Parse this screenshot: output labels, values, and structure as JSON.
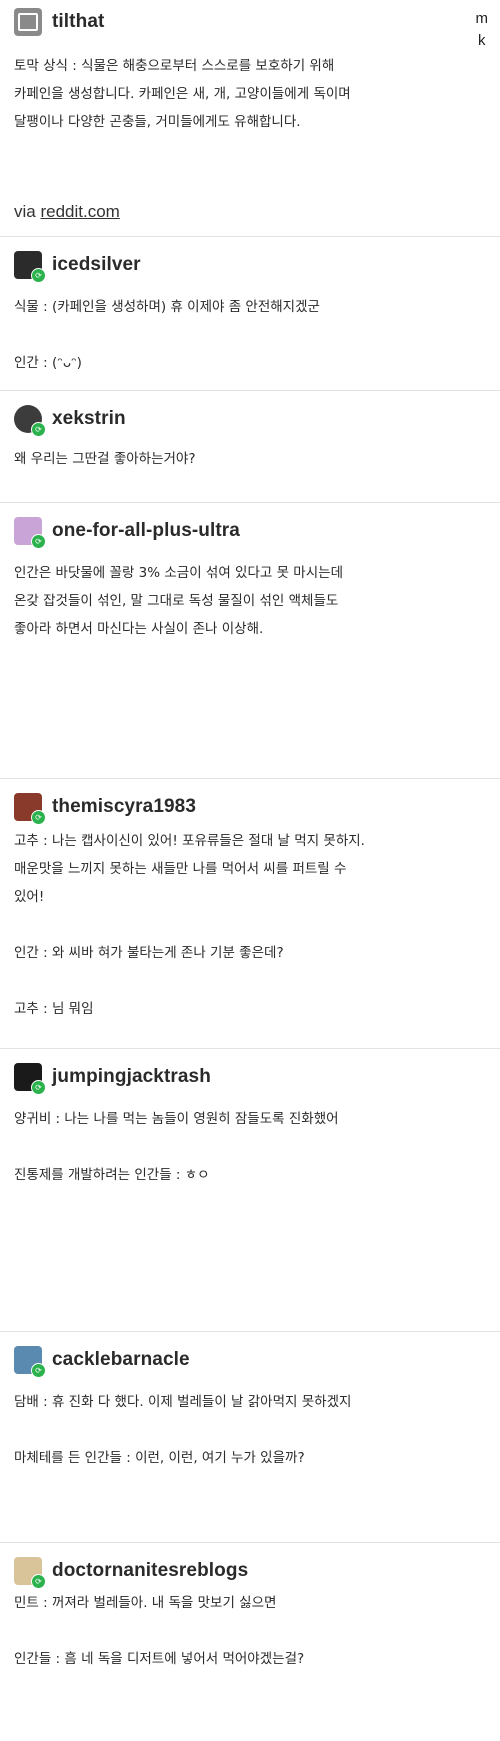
{
  "corner_letters": [
    "m",
    "k"
  ],
  "posts": [
    {
      "username": "tilthat",
      "text": "토막 상식 : 식물은 해충으로부터 스스로를 보호하기 위해\n카페인을 생성합니다. 카페인은 새, 개, 고양이들에게 독이며\n달팽이나 다양한 곤충들, 거미들에게도 유해합니다.",
      "via_prefix": "via",
      "via_link": "reddit.com",
      "avatar_color": "#6a6a6a"
    },
    {
      "username": "icedsilver",
      "text": "식물 : (카페인을 생성하며) 휴 이제야 좀 안전해지겠군\n\n인간 : (ᵔᴗᵔ)",
      "avatar_color": "#2b2b2b"
    },
    {
      "username": "xekstrin",
      "text": "왜 우리는 그딴걸 좋아하는거야?",
      "avatar_color": "#3c3c3c"
    },
    {
      "username": "one-for-all-plus-ultra",
      "text": "인간은 바닷물에 꼴랑 3% 소금이 섞여 있다고 못 마시는데\n온갖 잡것들이 섞인, 말 그대로 독성 물질이 섞인 액체들도\n좋아라 하면서 마신다는 사실이 존나 이상해.",
      "avatar_color": "#c9a4d6"
    },
    {
      "username": "themiscyra1983",
      "text": "고추 : 나는 캡사이신이 있어! 포유류들은 절대 날 먹지 못하지.\n매운맛을 느끼지 못하는 새들만 나를 먹어서 씨를 퍼트릴 수\n있어!\n\n인간 : 와 씨바 혀가 불타는게 존나 기분 좋은데?\n\n고추 : 님 뭐임",
      "avatar_color": "#8a3a2a"
    },
    {
      "username": "jumpingjacktrash",
      "text": "양귀비 : 나는 나를 먹는 놈들이 영원히 잠들도록 진화했어\n\n진통제를 개발하려는 인간들 : ㅎㅇ",
      "avatar_color": "#1a1a1a"
    },
    {
      "username": "cacklebarnacle",
      "text": "담배 : 휴 진화 다 했다. 이제 벌레들이 날 갉아먹지 못하겠지\n\n마체테를 든 인간들 : 이런, 이런, 여기 누가 있을까?",
      "avatar_color": "#5a8ab0"
    },
    {
      "username": "doctornanitesreblogs",
      "text": "민트 : 꺼져라 벌레들아. 내 독을 맛보기 싫으면\n\n인간들 : 흠 네 독을 디저트에 넣어서 먹어야겠는걸?",
      "avatar_color": "#d9c49a"
    }
  ]
}
